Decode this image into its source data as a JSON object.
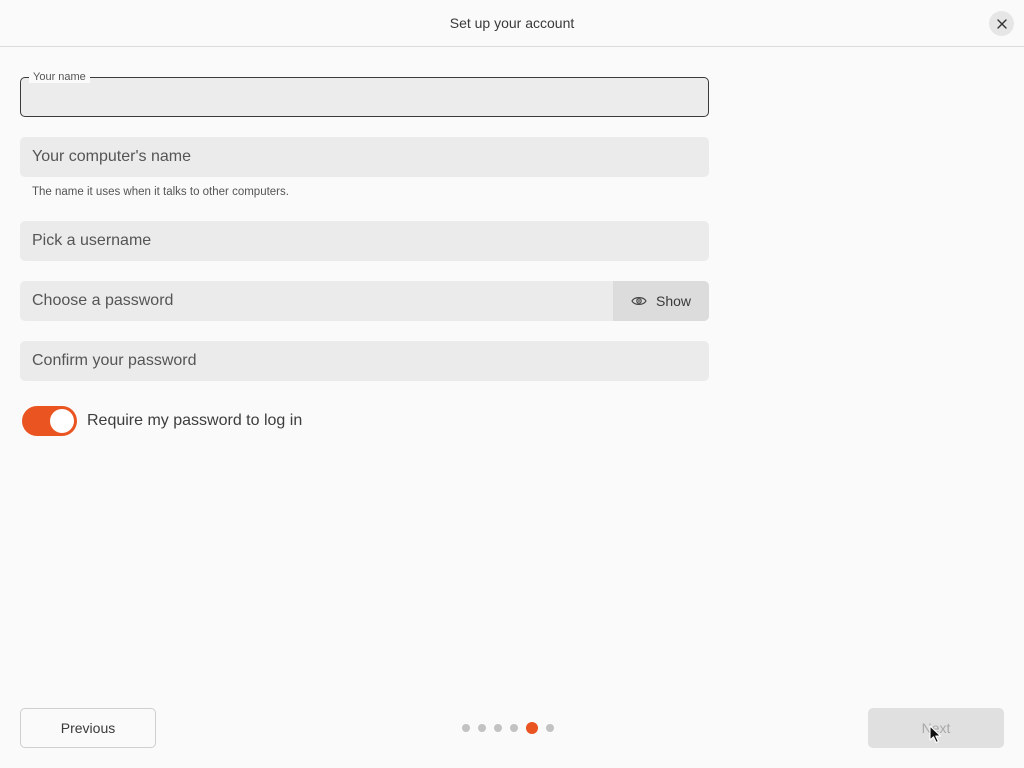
{
  "window": {
    "title": "Set up your account",
    "close_icon": "close-icon"
  },
  "form": {
    "name_label": "Your name",
    "name_value": "",
    "computer_name_placeholder": "Your computer's name",
    "computer_name_hint": "The name it uses when it talks to other computers.",
    "username_placeholder": "Pick a username",
    "password_placeholder": "Choose a password",
    "show_password_label": "Show",
    "show_password_icon": "eye-icon",
    "confirm_password_placeholder": "Confirm your password",
    "require_password_label": "Require my password to log in",
    "require_password_enabled": true
  },
  "navigation": {
    "previous_label": "Previous",
    "next_label": "Next",
    "next_enabled": false,
    "page_count": 6,
    "current_page": 5
  },
  "colors": {
    "accent": "#e95420",
    "background": "#fafafa",
    "field": "#ebebeb"
  }
}
